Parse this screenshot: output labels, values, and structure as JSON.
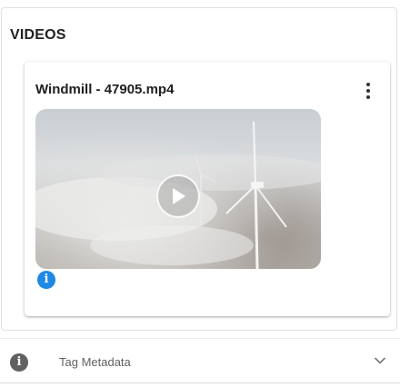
{
  "section": {
    "title": "VIDEOS"
  },
  "video_card": {
    "file_name": "Windmill - 47905.mp4",
    "menu_icon": "more-vert-icon",
    "play_icon": "play-circle-icon",
    "info_icon": "info-icon",
    "info_glyph": "i",
    "accent_color": "#1e88e5"
  },
  "metadata_accordion": {
    "label": "Tag Metadata",
    "icon": "info-icon",
    "icon_glyph": "i",
    "chevron_icon": "chevron-down-icon",
    "expanded": false
  }
}
